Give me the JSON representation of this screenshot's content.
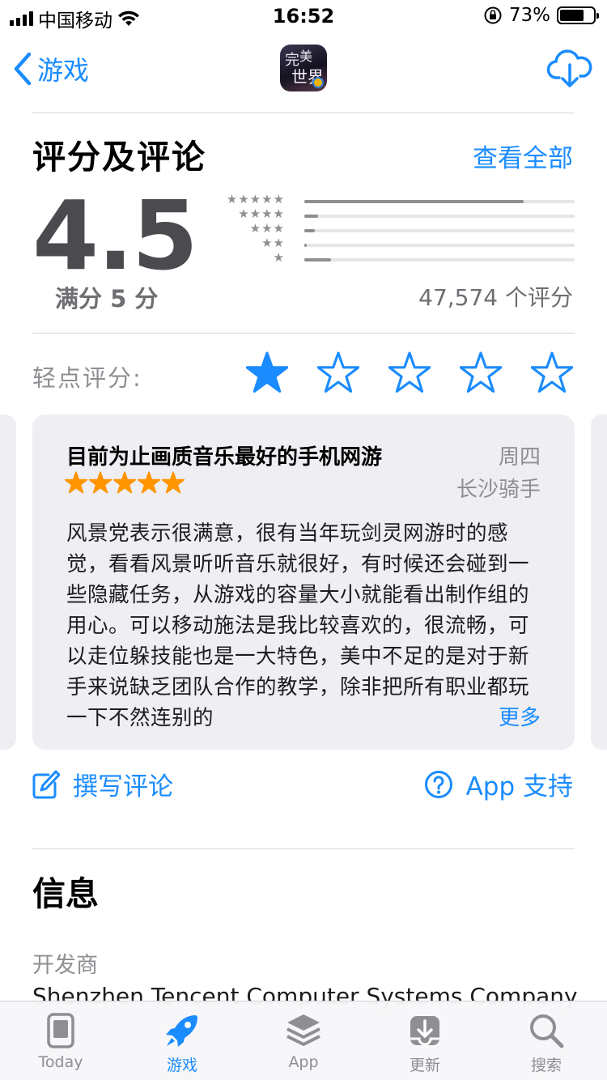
{
  "status_bar": {
    "carrier": "中国移动",
    "time": "16:52",
    "battery_percent_label": "73%",
    "battery_level": 0.73
  },
  "nav": {
    "back_label": "游戏",
    "app_icon_chars": [
      "完",
      "美",
      "世界"
    ]
  },
  "ratings": {
    "section_title": "评分及评论",
    "see_all": "查看全部",
    "score": "4.5",
    "out_of": "满分 5 分",
    "count_label": "47,574 个评分",
    "distribution": [
      {
        "stars": "★★★★★",
        "fraction": 0.81
      },
      {
        "stars": "★★★★",
        "fraction": 0.05
      },
      {
        "stars": "★★★",
        "fraction": 0.04
      },
      {
        "stars": "★★",
        "fraction": 0.01
      },
      {
        "stars": "★",
        "fraction": 0.1
      }
    ]
  },
  "tap_to_rate": {
    "label": "轻点评分:",
    "filled_count": 1,
    "total": 5
  },
  "review": {
    "title": "目前为止画质音乐最好的手机网游",
    "date": "周四",
    "author": "长沙骑手",
    "rating": 5,
    "body": "风景党表示很满意，很有当年玩剑灵网游时的感觉，看看风景听听音乐就很好，有时候还会碰到一些隐藏任务，从游戏的容量大小就能看出制作组的用心。可以移动施法是我比较喜欢的，很流畅，可以走位躲技能也是一大特色，美中不足的是对于新手来说缺乏团队合作的教学，除非把所有职业都玩一下不然连别的",
    "more": "更多"
  },
  "actions": {
    "write_review": "撰写评论",
    "app_support": "App 支持"
  },
  "info": {
    "title": "信息",
    "developer_label": "开发商",
    "developer_value": "Shenzhen Tencent Computer Systems Company"
  },
  "tabs": [
    {
      "label": "Today",
      "icon": "today-icon",
      "active": false
    },
    {
      "label": "游戏",
      "icon": "rocket-icon",
      "active": true
    },
    {
      "label": "App",
      "icon": "layers-icon",
      "active": false
    },
    {
      "label": "更新",
      "icon": "download-tray-icon",
      "active": false
    },
    {
      "label": "搜索",
      "icon": "search-icon",
      "active": false
    }
  ],
  "colors": {
    "accent": "#1a8cff",
    "review_star": "#ff9500",
    "card_bg": "#eeeef3"
  }
}
